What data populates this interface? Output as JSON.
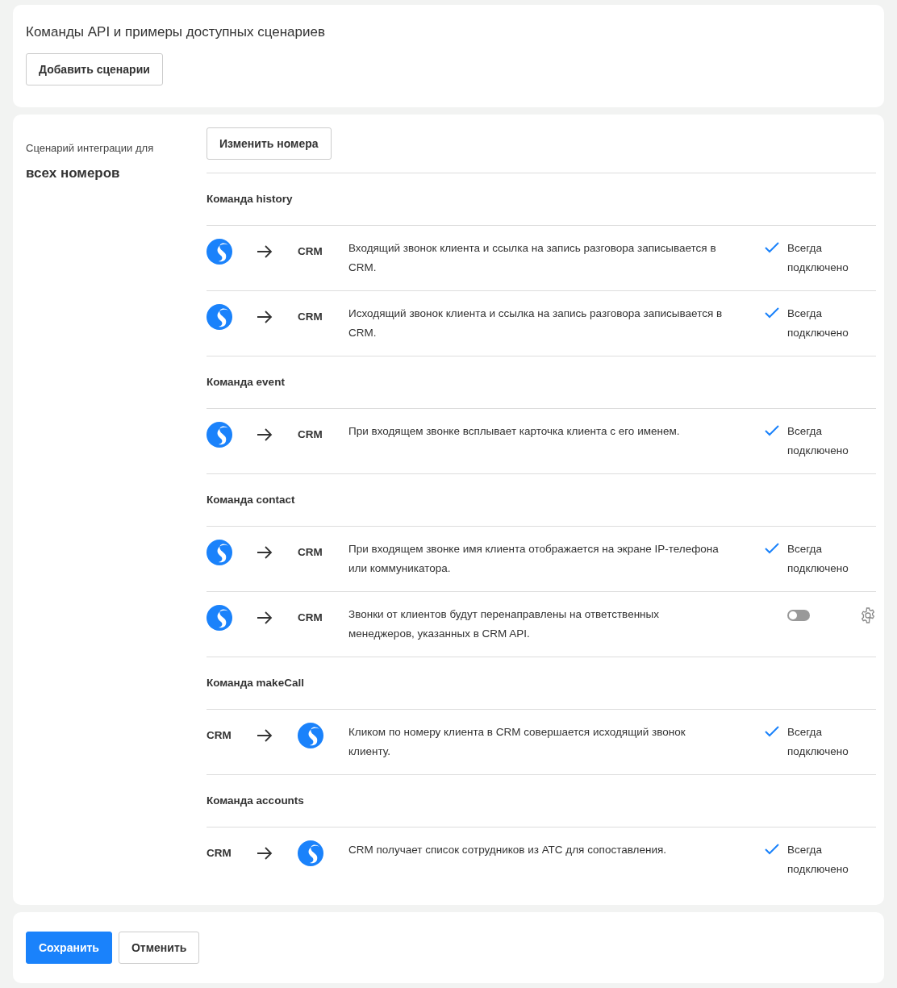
{
  "header": {
    "title": "Команды API и примеры доступных сценариев",
    "add_button": "Добавить сценарии"
  },
  "scenario": {
    "label": "Сценарий интеграции для",
    "target": "всех номеров",
    "change_button": "Изменить номера"
  },
  "sections": [
    {
      "title": "Команда history",
      "rows": [
        {
          "kind": "to_crm",
          "crm": "CRM",
          "description": "Входящий звонок клиента и ссылка на запись разговора записывается в CRM.",
          "status": {
            "kind": "always",
            "text": "Всегда подключено"
          }
        },
        {
          "kind": "to_crm",
          "crm": "CRM",
          "description": "Исходящий звонок клиента и ссылка на запись разговора записывается в CRM.",
          "status": {
            "kind": "always",
            "text": "Всегда подключено"
          }
        }
      ]
    },
    {
      "title": "Команда event",
      "rows": [
        {
          "kind": "to_crm",
          "crm": "CRM",
          "description": "При входящем звонке всплывает карточка клиента с его именем.",
          "status": {
            "kind": "always",
            "text": "Всегда подключено"
          }
        }
      ]
    },
    {
      "title": "Команда contact",
      "rows": [
        {
          "kind": "to_crm",
          "crm": "CRM",
          "description": "При входящем звонке имя клиента отображается на экране IP-телефона или коммуникатора.",
          "status": {
            "kind": "always",
            "text": "Всегда подключено"
          }
        },
        {
          "kind": "to_crm",
          "crm": "CRM",
          "description": "Звонки от клиентов будут перенаправлены на ответственных менеджеров, указанных в CRM API.",
          "status": {
            "kind": "toggle",
            "on": false
          }
        }
      ]
    },
    {
      "title": "Команда makeCall",
      "rows": [
        {
          "kind": "from_crm",
          "crm": "CRM",
          "description": "Кликом по номеру клиента в CRM совершается исходящий звонок клиенту.",
          "status": {
            "kind": "always",
            "text": "Всегда подключено"
          }
        }
      ]
    },
    {
      "title": "Команда accounts",
      "rows": [
        {
          "kind": "from_crm",
          "crm": "CRM",
          "description": "CRM получает список сотрудников из АТС для сопоставления.",
          "status": {
            "kind": "always",
            "text": "Всегда подключено"
          }
        }
      ]
    }
  ],
  "footer": {
    "save": "Сохранить",
    "cancel": "Отменить"
  }
}
